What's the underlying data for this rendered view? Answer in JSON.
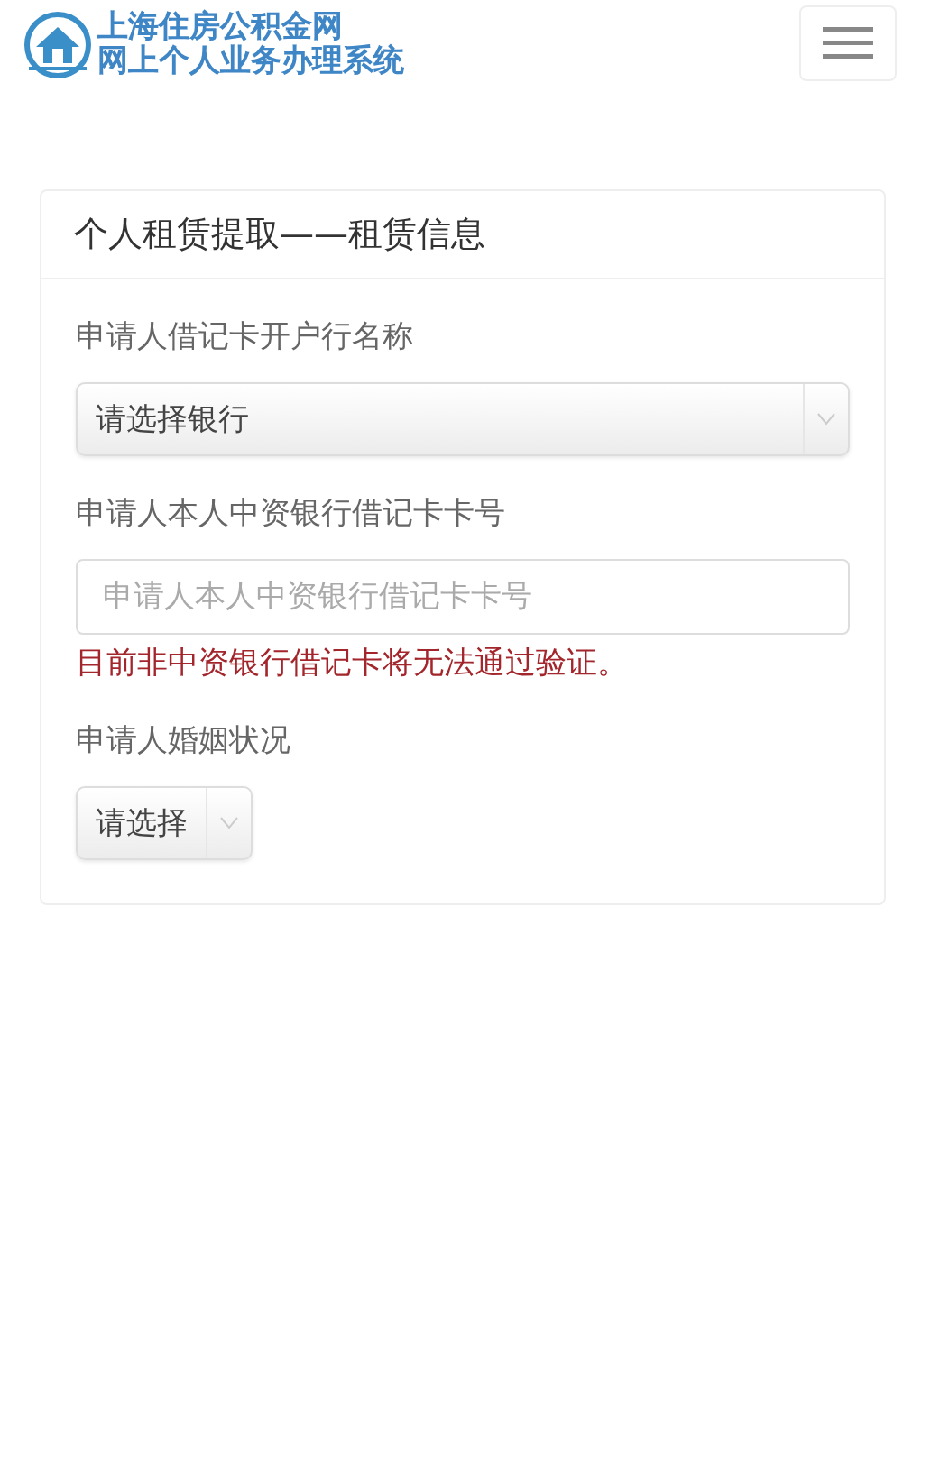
{
  "header": {
    "logo_lines": [
      "上海住房公积金网",
      "网上个人业务办理系统"
    ]
  },
  "card": {
    "title": "个人租赁提取——租赁信息",
    "fields": [
      {
        "kind": "select",
        "label": "申请人借记卡开户行名称",
        "value": "请选择银行"
      },
      {
        "kind": "input",
        "label": "申请人本人中资银行借记卡卡号",
        "placeholder": "申请人本人中资银行借记卡卡号",
        "hint": "目前非中资银行借记卡将无法通过验证。"
      },
      {
        "kind": "inline-select",
        "label": "申请人婚姻状况",
        "value": "请选择"
      }
    ]
  }
}
